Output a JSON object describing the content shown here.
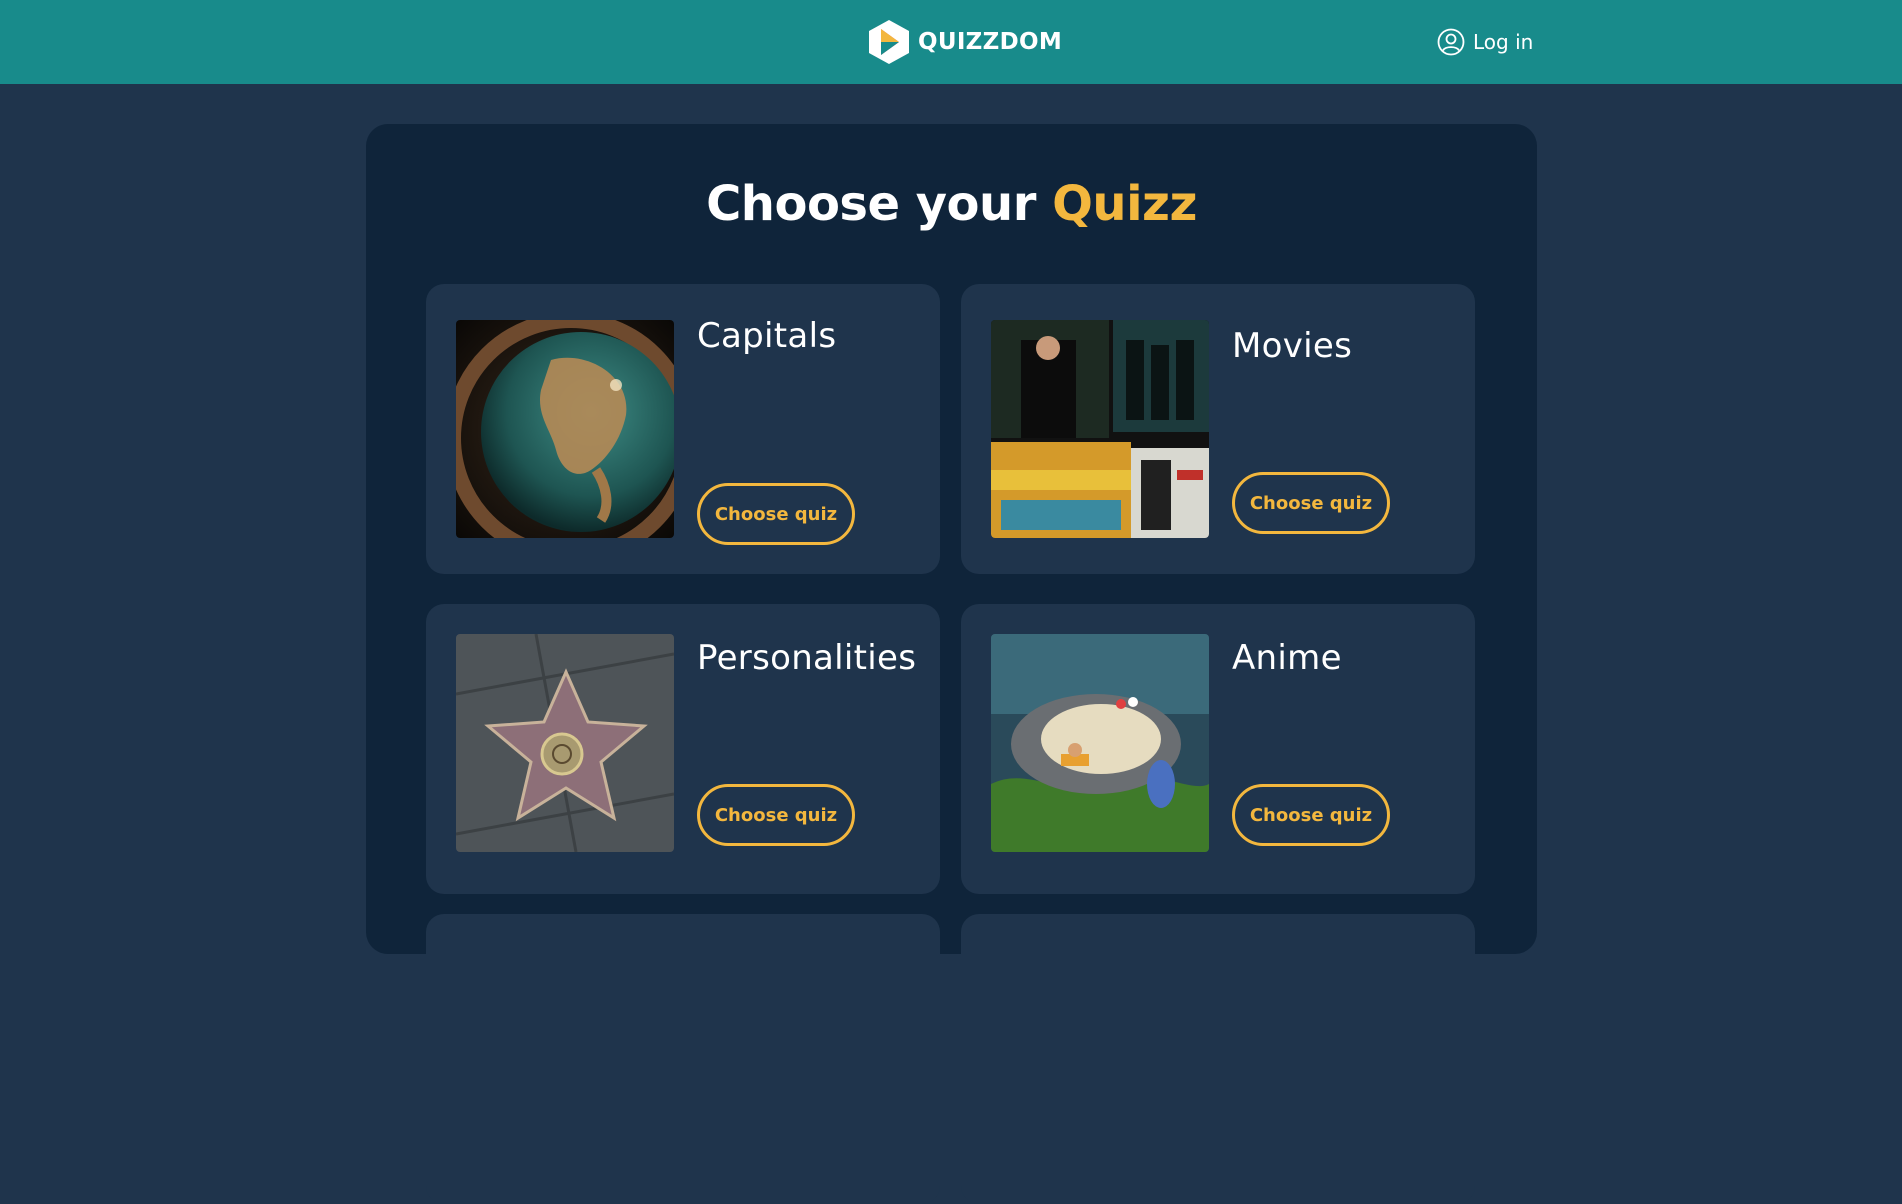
{
  "header": {
    "brand": "QUIZZDOM",
    "logo_icon": "quizzdom-logo-icon",
    "login_label": "Log in",
    "login_icon": "user-circle-icon",
    "background": "#188b8b"
  },
  "main": {
    "title_part1": "Choose your",
    "title_accent": "Quizz",
    "accent_color": "#f3b73e",
    "quizzes": [
      {
        "title": "Capitals",
        "button_label": "Choose quiz",
        "image": "globe-image"
      },
      {
        "title": "Movies",
        "button_label": "Choose quiz",
        "image": "movie-posters-image"
      },
      {
        "title": "Personalities",
        "button_label": "Choose quiz",
        "image": "walk-of-fame-star-image"
      },
      {
        "title": "Anime",
        "button_label": "Choose quiz",
        "image": "anime-scene-image"
      }
    ]
  },
  "colors": {
    "page_background": "#1f344c",
    "panel_background": "#0f243a",
    "card_background": "#1f344c"
  }
}
